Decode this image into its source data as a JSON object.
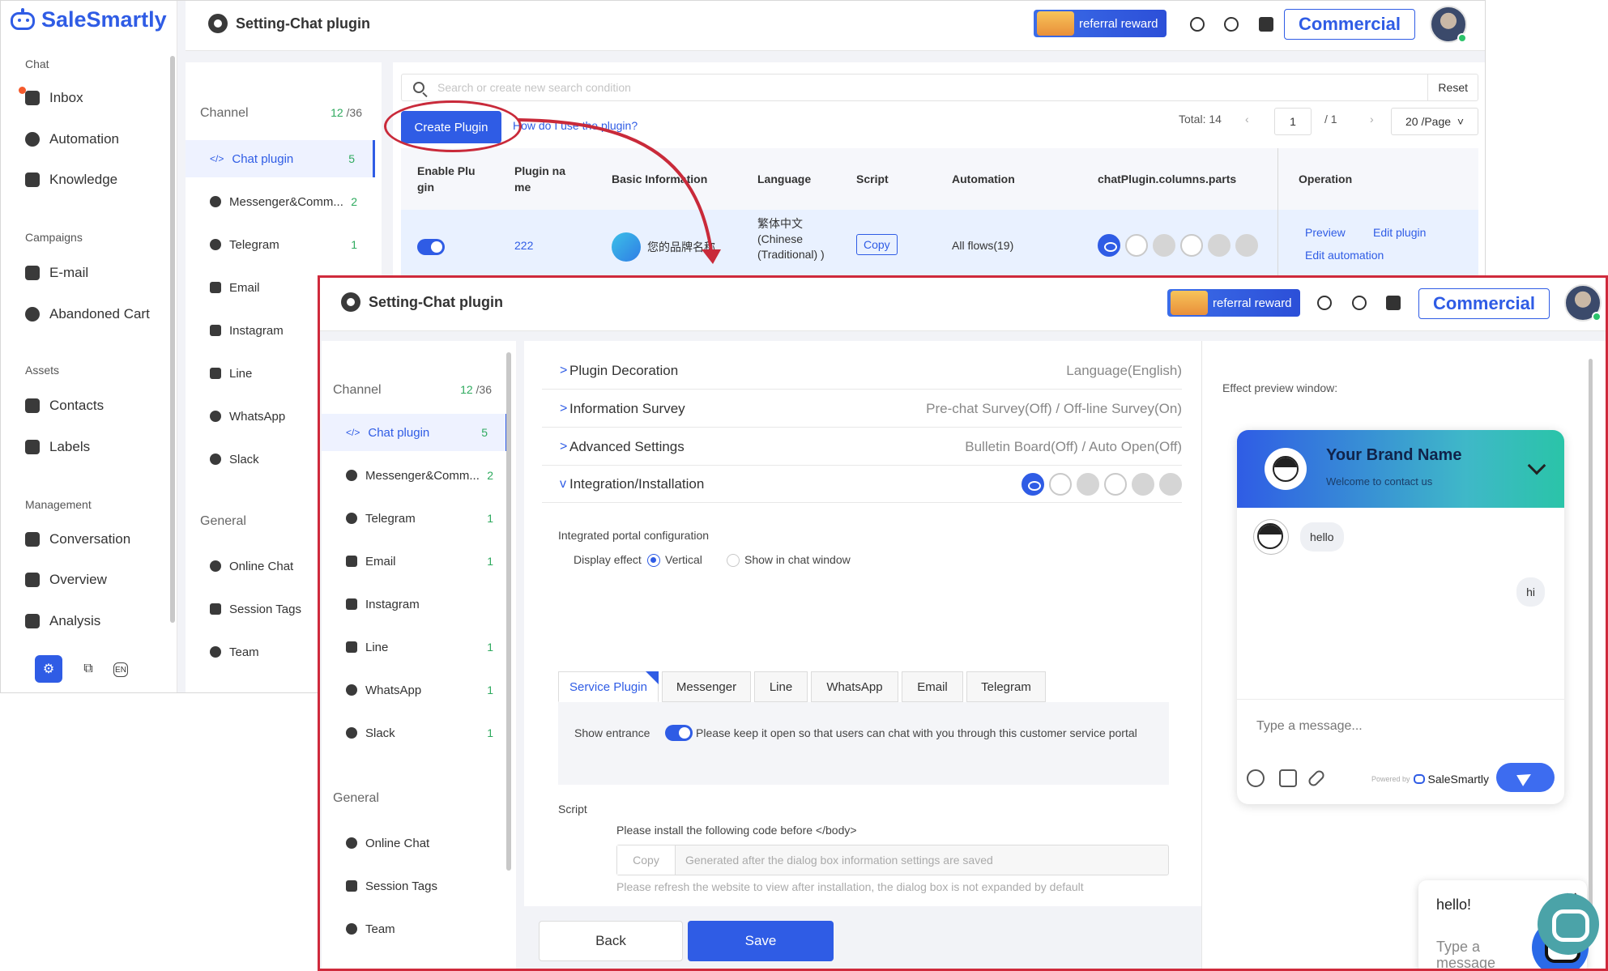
{
  "app": {
    "brand": "SaleSmartly"
  },
  "sidebar": {
    "sections": [
      {
        "title": "Chat",
        "items": [
          "Inbox",
          "Automation",
          "Knowledge"
        ]
      },
      {
        "title": "Campaigns",
        "items": [
          "E-mail",
          "Abandoned Cart"
        ]
      },
      {
        "title": "Assets",
        "items": [
          "Contacts",
          "Labels"
        ]
      },
      {
        "title": "Management",
        "items": [
          "Conversation",
          "Overview",
          "Analysis"
        ]
      }
    ],
    "bottom_icons": [
      "settings-icon",
      "devices-icon",
      "language-en-icon"
    ],
    "lang_label": "EN"
  },
  "header": {
    "title": "Setting-Chat plugin",
    "referral": "referral reward",
    "plan": "Commercial"
  },
  "channel_panel": {
    "heading": "Channel",
    "count_used": "12",
    "count_total": "/36",
    "channels": [
      {
        "label": "Chat plugin",
        "count": "5"
      },
      {
        "label": "Messenger&Comm...",
        "count": "2"
      },
      {
        "label": "Telegram",
        "count": "1"
      },
      {
        "label": "Email",
        "count": "1"
      },
      {
        "label": "Instagram",
        "count": ""
      },
      {
        "label": "Line",
        "count": "1"
      },
      {
        "label": "WhatsApp",
        "count": "1"
      },
      {
        "label": "Slack",
        "count": "1"
      }
    ],
    "general_heading": "General",
    "general": [
      "Online Chat",
      "Session Tags",
      "Team"
    ]
  },
  "list_view": {
    "search_placeholder": "Search or create new search condition",
    "reset": "Reset",
    "create_button": "Create Plugin",
    "how_link": "How do I use the plugin?",
    "total": "Total: 14",
    "page": "1",
    "of_pages": "/ 1",
    "page_size": "20 /Page",
    "columns": [
      "Enable Plu gin",
      "Plugin na me",
      "Basic Information",
      "Language",
      "Script",
      "Automation",
      "chatPlugin.columns.parts",
      "Operation"
    ],
    "row": {
      "name": "222",
      "brand": "您的品牌名称",
      "language": "繁体中文 (Chinese (Traditional) )",
      "script": "Copy",
      "automation": "All flows(19)",
      "op_preview": "Preview",
      "op_edit": "Edit plugin",
      "op_automation": "Edit automation"
    }
  },
  "edit_view": {
    "sections": [
      {
        "title": "Plugin Decoration",
        "value": "Language(English)",
        "chevron": ">"
      },
      {
        "title": "Information Survey",
        "value": "Pre-chat Survey(Off) / Off-line Survey(On)",
        "chevron": ">"
      },
      {
        "title": "Advanced Settings",
        "value": "Bulletin Board(Off) / Auto Open(Off)",
        "chevron": ">"
      },
      {
        "title": "Integration/Installation",
        "value": "",
        "chevron": "v"
      }
    ],
    "integrated_label": "Integrated portal configuration",
    "display_effect_label": "Display effect",
    "option_vertical": "Vertical",
    "option_in_window": "Show in chat window",
    "tabs": [
      "Service Plugin",
      "Messenger",
      "Line",
      "WhatsApp",
      "Email",
      "Telegram"
    ],
    "show_entrance_label": "Show entrance",
    "show_entrance_hint": "Please keep it open so that users can chat with you through this customer service portal",
    "script_label": "Script",
    "install_hint": "Please install the following code before </body>",
    "copy": "Copy",
    "generated_placeholder": "Generated after the dialog box information settings are saved",
    "refresh_hint": "Please refresh the website to view after installation, the dialog box is not expanded by default",
    "back": "Back",
    "save": "Save"
  },
  "preview": {
    "label": "Effect preview window:",
    "brand_name": "Your Brand Name",
    "welcome": "Welcome to contact us",
    "msg_in": "hello",
    "msg_out": "hi",
    "input_placeholder": "Type a message...",
    "powered_by": "Powered by",
    "powered_brand": "SaleSmartly",
    "popup_hello": "hello!",
    "popup_placeholder": "Type a message",
    "close": "✕"
  },
  "colors": {
    "accent": "#2f5ce5",
    "annotation": "#cf2a3c",
    "count_green": "#2eaa5e"
  }
}
